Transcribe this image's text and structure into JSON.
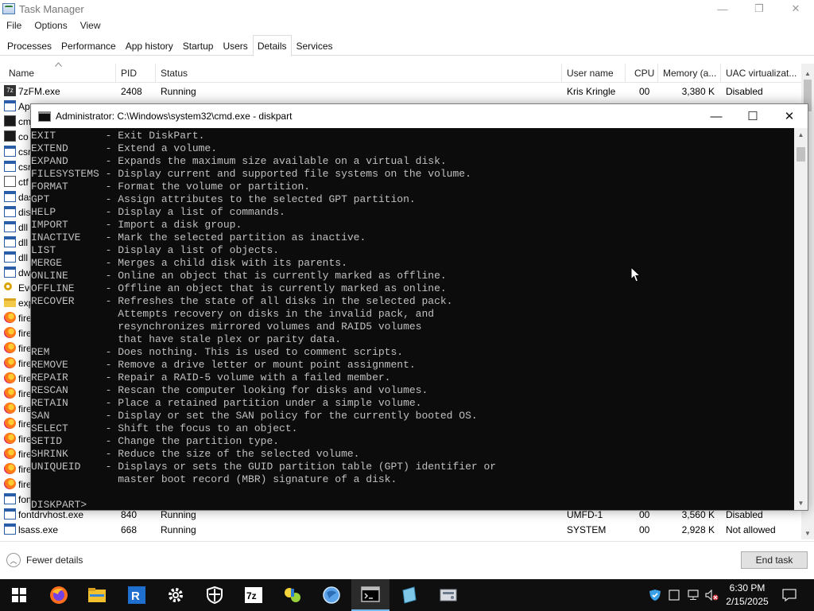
{
  "taskmanager": {
    "title": "Task Manager",
    "caption": {
      "minimize": "—",
      "maximize": "❐",
      "close": "✕"
    },
    "menu": [
      "File",
      "Options",
      "View"
    ],
    "tabs": [
      "Processes",
      "Performance",
      "App history",
      "Startup",
      "Users",
      "Details",
      "Services"
    ],
    "active_tab": "Details",
    "columns": [
      "Name",
      "PID",
      "Status",
      "User name",
      "CPU",
      "Memory (a...",
      "UAC virtualizat..."
    ],
    "rows": [
      {
        "name": "7zFM.exe",
        "pid": "2408",
        "status": "Running",
        "user": "Kris Kringle",
        "cpu": "00",
        "memory": "3,380 K",
        "uac": "Disabled",
        "icon": "zip"
      },
      {
        "name": "Ap",
        "pid": "",
        "status": "",
        "user": "",
        "cpu": "",
        "memory": "",
        "uac": "",
        "icon": "exe"
      },
      {
        "name": "cm",
        "pid": "",
        "status": "",
        "user": "",
        "cpu": "",
        "memory": "",
        "uac": "",
        "icon": "cmd"
      },
      {
        "name": "co",
        "pid": "",
        "status": "",
        "user": "",
        "cpu": "",
        "memory": "",
        "uac": "",
        "icon": "cmd"
      },
      {
        "name": "csr",
        "pid": "",
        "status": "",
        "user": "",
        "cpu": "",
        "memory": "",
        "uac": "",
        "icon": "exe"
      },
      {
        "name": "csr",
        "pid": "",
        "status": "",
        "user": "",
        "cpu": "",
        "memory": "",
        "uac": "",
        "icon": "exe"
      },
      {
        "name": "ctf",
        "pid": "",
        "status": "",
        "user": "",
        "cpu": "",
        "memory": "",
        "uac": "",
        "icon": "edit"
      },
      {
        "name": "das",
        "pid": "",
        "status": "",
        "user": "",
        "cpu": "",
        "memory": "",
        "uac": "",
        "icon": "exe"
      },
      {
        "name": "dis",
        "pid": "",
        "status": "",
        "user": "",
        "cpu": "",
        "memory": "",
        "uac": "",
        "icon": "exe"
      },
      {
        "name": "dll",
        "pid": "",
        "status": "",
        "user": "",
        "cpu": "",
        "memory": "",
        "uac": "",
        "icon": "exe"
      },
      {
        "name": "dll",
        "pid": "",
        "status": "",
        "user": "",
        "cpu": "",
        "memory": "",
        "uac": "",
        "icon": "exe"
      },
      {
        "name": "dll",
        "pid": "",
        "status": "",
        "user": "",
        "cpu": "",
        "memory": "",
        "uac": "",
        "icon": "exe"
      },
      {
        "name": "dw",
        "pid": "",
        "status": "",
        "user": "",
        "cpu": "",
        "memory": "",
        "uac": "",
        "icon": "exe"
      },
      {
        "name": "Eve",
        "pid": "",
        "status": "",
        "user": "",
        "cpu": "",
        "memory": "",
        "uac": "",
        "icon": "key"
      },
      {
        "name": "exp",
        "pid": "",
        "status": "",
        "user": "",
        "cpu": "",
        "memory": "",
        "uac": "",
        "icon": "folder"
      },
      {
        "name": "fire",
        "pid": "",
        "status": "",
        "user": "",
        "cpu": "",
        "memory": "",
        "uac": "",
        "icon": "fox"
      },
      {
        "name": "fire",
        "pid": "",
        "status": "",
        "user": "",
        "cpu": "",
        "memory": "",
        "uac": "",
        "icon": "fox"
      },
      {
        "name": "fire",
        "pid": "",
        "status": "",
        "user": "",
        "cpu": "",
        "memory": "",
        "uac": "",
        "icon": "fox"
      },
      {
        "name": "fire",
        "pid": "",
        "status": "",
        "user": "",
        "cpu": "",
        "memory": "",
        "uac": "",
        "icon": "fox"
      },
      {
        "name": "fire",
        "pid": "",
        "status": "",
        "user": "",
        "cpu": "",
        "memory": "",
        "uac": "",
        "icon": "fox"
      },
      {
        "name": "fire",
        "pid": "",
        "status": "",
        "user": "",
        "cpu": "",
        "memory": "",
        "uac": "",
        "icon": "fox"
      },
      {
        "name": "fire",
        "pid": "",
        "status": "",
        "user": "",
        "cpu": "",
        "memory": "",
        "uac": "",
        "icon": "fox"
      },
      {
        "name": "fire",
        "pid": "",
        "status": "",
        "user": "",
        "cpu": "",
        "memory": "",
        "uac": "",
        "icon": "fox"
      },
      {
        "name": "fire",
        "pid": "",
        "status": "",
        "user": "",
        "cpu": "",
        "memory": "",
        "uac": "",
        "icon": "fox"
      },
      {
        "name": "fire",
        "pid": "",
        "status": "",
        "user": "",
        "cpu": "",
        "memory": "",
        "uac": "",
        "icon": "fox"
      },
      {
        "name": "fire",
        "pid": "",
        "status": "",
        "user": "",
        "cpu": "",
        "memory": "",
        "uac": "",
        "icon": "fox"
      },
      {
        "name": "fire",
        "pid": "",
        "status": "",
        "user": "",
        "cpu": "",
        "memory": "",
        "uac": "",
        "icon": "fox"
      },
      {
        "name": "fon",
        "pid": "",
        "status": "",
        "user": "",
        "cpu": "",
        "memory": "",
        "uac": "",
        "icon": "exe"
      },
      {
        "name": "fontdrvhost.exe",
        "pid": "840",
        "status": "Running",
        "user": "UMFD-1",
        "cpu": "00",
        "memory": "3,560 K",
        "uac": "Disabled",
        "icon": "exe"
      },
      {
        "name": "lsass.exe",
        "pid": "668",
        "status": "Running",
        "user": "SYSTEM",
        "cpu": "00",
        "memory": "2,928 K",
        "uac": "Not allowed",
        "icon": "exe"
      }
    ],
    "fewer_details": "Fewer details",
    "end_task": "End task"
  },
  "console": {
    "title": "Administrator: C:\\Windows\\system32\\cmd.exe - diskpart",
    "caption": {
      "minimize": "—",
      "maximize": "☐",
      "close": "✕"
    },
    "lines": [
      "EXIT        - Exit DiskPart.",
      "EXTEND      - Extend a volume.",
      "EXPAND      - Expands the maximum size available on a virtual disk.",
      "FILESYSTEMS - Display current and supported file systems on the volume.",
      "FORMAT      - Format the volume or partition.",
      "GPT         - Assign attributes to the selected GPT partition.",
      "HELP        - Display a list of commands.",
      "IMPORT      - Import a disk group.",
      "INACTIVE    - Mark the selected partition as inactive.",
      "LIST        - Display a list of objects.",
      "MERGE       - Merges a child disk with its parents.",
      "ONLINE      - Online an object that is currently marked as offline.",
      "OFFLINE     - Offline an object that is currently marked as online.",
      "RECOVER     - Refreshes the state of all disks in the selected pack.",
      "              Attempts recovery on disks in the invalid pack, and",
      "              resynchronizes mirrored volumes and RAID5 volumes",
      "              that have stale plex or parity data.",
      "REM         - Does nothing. This is used to comment scripts.",
      "REMOVE      - Remove a drive letter or mount point assignment.",
      "REPAIR      - Repair a RAID-5 volume with a failed member.",
      "RESCAN      - Rescan the computer looking for disks and volumes.",
      "RETAIN      - Place a retained partition under a simple volume.",
      "SAN         - Display or set the SAN policy for the currently booted OS.",
      "SELECT      - Shift the focus to an object.",
      "SETID       - Change the partition type.",
      "SHRINK      - Reduce the size of the selected volume.",
      "UNIQUEID    - Displays or sets the GUID partition table (GPT) identifier or",
      "              master boot record (MBR) signature of a disk.",
      "",
      "DISKPART> "
    ]
  },
  "taskbar": {
    "apps": [
      "firefox-icon",
      "file-explorer-icon",
      "rdp-icon",
      "settings-icon",
      "security-icon",
      "7zip-icon",
      "tool-icon",
      "globe-icon",
      "terminal-icon",
      "notepad-icon",
      "disk-icon"
    ],
    "active_app": "terminal-icon",
    "clock_time": "6:30 PM",
    "clock_date": "2/15/2025"
  },
  "colors": {
    "console_bg": "#0c0c0c",
    "console_fg": "#c0c0c0",
    "taskbar_bg": "#0f0f0f",
    "accent": "#76b9ed"
  }
}
